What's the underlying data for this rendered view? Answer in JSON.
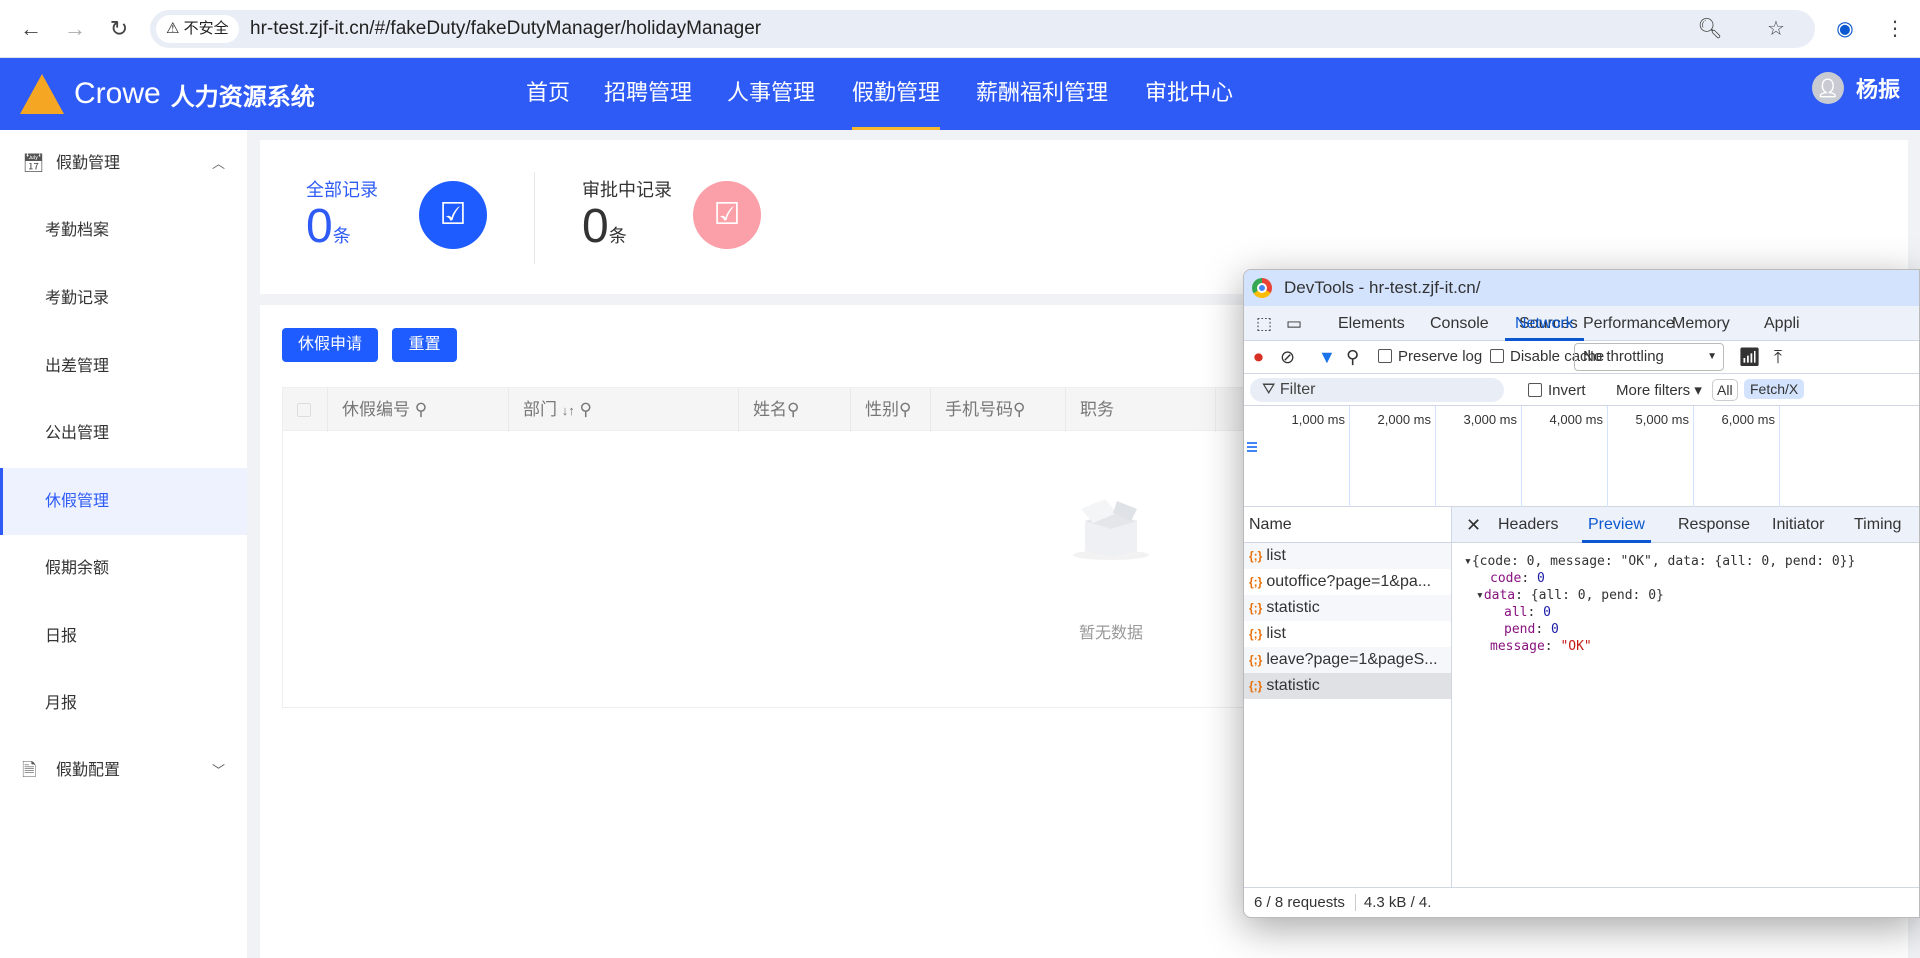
{
  "browser": {
    "insecure_label": "不安全",
    "url": "hr-test.zjf-it.cn/#/fakeDuty/fakeDutyManager/holidayManager"
  },
  "header": {
    "brand": "Crowe",
    "system_name": "人力资源系统",
    "nav": [
      "首页",
      "招聘管理",
      "人事管理",
      "假勤管理",
      "薪酬福利管理",
      "审批中心"
    ],
    "active_nav": "假勤管理",
    "user_name": "杨振",
    "accent": "#2e5bf6"
  },
  "sidebar": {
    "group1": "假勤管理",
    "items": [
      "考勤档案",
      "考勤记录",
      "出差管理",
      "公出管理",
      "休假管理",
      "假期余额",
      "日报",
      "月报"
    ],
    "active": "休假管理",
    "group2": "假勤配置"
  },
  "stats": {
    "all_label": "全部记录",
    "all_value": "0",
    "pending_label": "审批中记录",
    "pending_value": "0",
    "unit": "条"
  },
  "toolbar": {
    "apply_label": "休假申请",
    "reset_label": "重置"
  },
  "table": {
    "columns": [
      "休假编号",
      "部门",
      "姓名",
      "性别",
      "手机号码",
      "职务"
    ],
    "sort_hint": "↓↑",
    "empty_text": "暂无数据"
  },
  "devtools": {
    "title": "DevTools - hr-test.zjf-it.cn/",
    "tabs": [
      "Elements",
      "Console",
      "Sources",
      "Network",
      "Performance",
      "Memory",
      "Appli"
    ],
    "active_tab": "Network",
    "preserve_log": "Preserve log",
    "disable_cache": "Disable cache",
    "throttling": "No throttling",
    "filter_placeholder": "Filter",
    "invert": "Invert",
    "more_filters": "More filters",
    "type_all": "All",
    "type_fetch": "Fetch/X",
    "timeline_ticks": [
      "1,000 ms",
      "2,000 ms",
      "3,000 ms",
      "4,000 ms",
      "5,000 ms",
      "6,000 ms"
    ],
    "name_header": "Name",
    "requests": [
      "list",
      "outoffice?page=1&pa...",
      "statistic",
      "list",
      "leave?page=1&pageS...",
      "statistic"
    ],
    "selected_request": 5,
    "detail_tabs": [
      "Headers",
      "Preview",
      "Response",
      "Initiator",
      "Timing"
    ],
    "active_detail_tab": "Preview",
    "preview": {
      "summary": "{code: 0, message: \"OK\", data: {all: 0, pend: 0}}",
      "code": "0",
      "data_summary": "{all: 0, pend: 0}",
      "all": "0",
      "pend": "0",
      "message": "\"OK\""
    },
    "status_requests": "6 / 8 requests",
    "status_size": "4.3 kB / 4."
  }
}
